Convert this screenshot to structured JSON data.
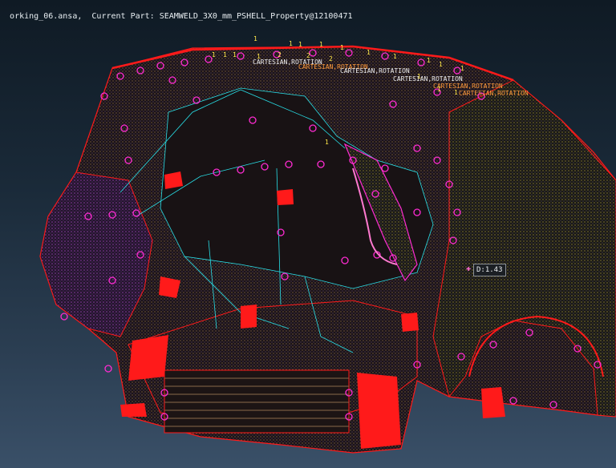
{
  "title_bar": {
    "file": "orking_06.ansa,",
    "current_part": "Current Part: SEAMWELD_3X0_mm_PSHELL_Property@12100471"
  },
  "annotations": {
    "cartesian_labels": [
      "CARTESIAN,ROTATION",
      "CARTESIAN,ROTATION",
      "CARTESIAN,ROTATION",
      "CARTESIAN,ROTATION",
      "CARTESIAN,ROTATION",
      "CARTESIAN,ROTATION"
    ],
    "number_labels": [
      "1",
      "1",
      "1",
      "1",
      "1",
      "1",
      "1",
      "1",
      "1",
      "1",
      "1",
      "1",
      "1",
      "1",
      "1",
      "2",
      "2",
      "2",
      "1",
      "1",
      "1"
    ],
    "distance_readout": "D:1.43"
  },
  "colors": {
    "weld_magenta": "#ff2bd2",
    "edge_red": "#ff1a1a",
    "edge_cyan": "#28e0e8",
    "label_orange": "#ff9a3c",
    "label_white": "#f0f0f0",
    "number_yellow": "#ffe84a"
  }
}
